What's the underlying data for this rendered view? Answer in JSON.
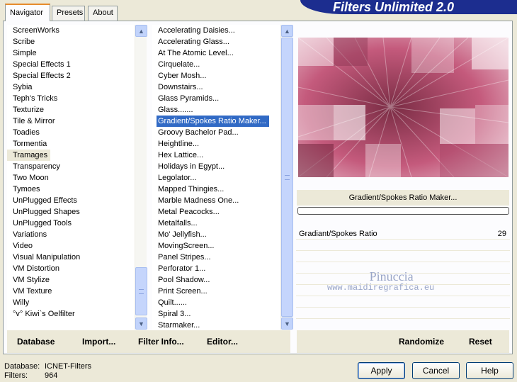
{
  "tabs": [
    "Navigator",
    "Presets",
    "About"
  ],
  "banner_title": "Filters Unlimited 2.0",
  "categories": [
    "ScreenWorks",
    "Scribe",
    "Simple",
    "Special Effects 1",
    "Special Effects 2",
    "Sybia",
    "Teph's Tricks",
    "Texturize",
    "Tile & Mirror",
    "Toadies",
    "Tormentia",
    "Tramages",
    "Transparency",
    "Two Moon",
    "Tymoes",
    "UnPlugged Effects",
    "UnPlugged Shapes",
    "UnPlugged Tools",
    "Variations",
    "Video",
    "Visual Manipulation",
    "VM Distortion",
    "VM Stylize",
    "VM Texture",
    "Willy",
    "°v° Kiwi`s Oelfilter"
  ],
  "selected_category": "Tramages",
  "filters": [
    "Accelerating Daisies...",
    "Accelerating Glass...",
    "At The Atomic Level...",
    "Cirquelate...",
    "Cyber Mosh...",
    "Downstairs...",
    "Glass Pyramids...",
    "Glass.......",
    "Gradient/Spokes Ratio Maker...",
    "Groovy Bachelor Pad...",
    "Heightline...",
    "Hex Lattice...",
    "Holidays in Egypt...",
    "Legolator...",
    "Mapped Thingies...",
    "Marble Madness One...",
    "Metal Peacocks...",
    "Metalfalls...",
    "Mo' Jellyfish...",
    "MovingScreen...",
    "Panel Stripes...",
    "Perforator 1...",
    "Pool Shadow...",
    "Print Screen...",
    "Quilt......",
    "Spiral 3...",
    "Starmaker..."
  ],
  "selected_filter": "Gradient/Spokes Ratio Maker...",
  "effect_name": "Gradient/Spokes Ratio Maker...",
  "param": {
    "name": "Gradiant/Spokes Ratio",
    "value": "29"
  },
  "watermark": {
    "name": "Pinuccia",
    "url": "www.maidiregrafica.eu"
  },
  "buttons_left": {
    "database": "Database",
    "import": "Import...",
    "filter_info": "Filter Info...",
    "editor": "Editor..."
  },
  "buttons_right": {
    "randomize": "Randomize",
    "reset": "Reset"
  },
  "footer": {
    "database_label": "Database:",
    "database_value": "ICNET-Filters",
    "filters_label": "Filters:",
    "filters_value": "964"
  },
  "dialog": {
    "apply": "Apply",
    "cancel": "Cancel",
    "help": "Help"
  },
  "colors": {
    "selection": "#316ac5",
    "banner": "#1c2d8f",
    "preview_base": "#b04a6a"
  },
  "icons": {
    "scroll_up": "▲",
    "scroll_down": "▼"
  }
}
